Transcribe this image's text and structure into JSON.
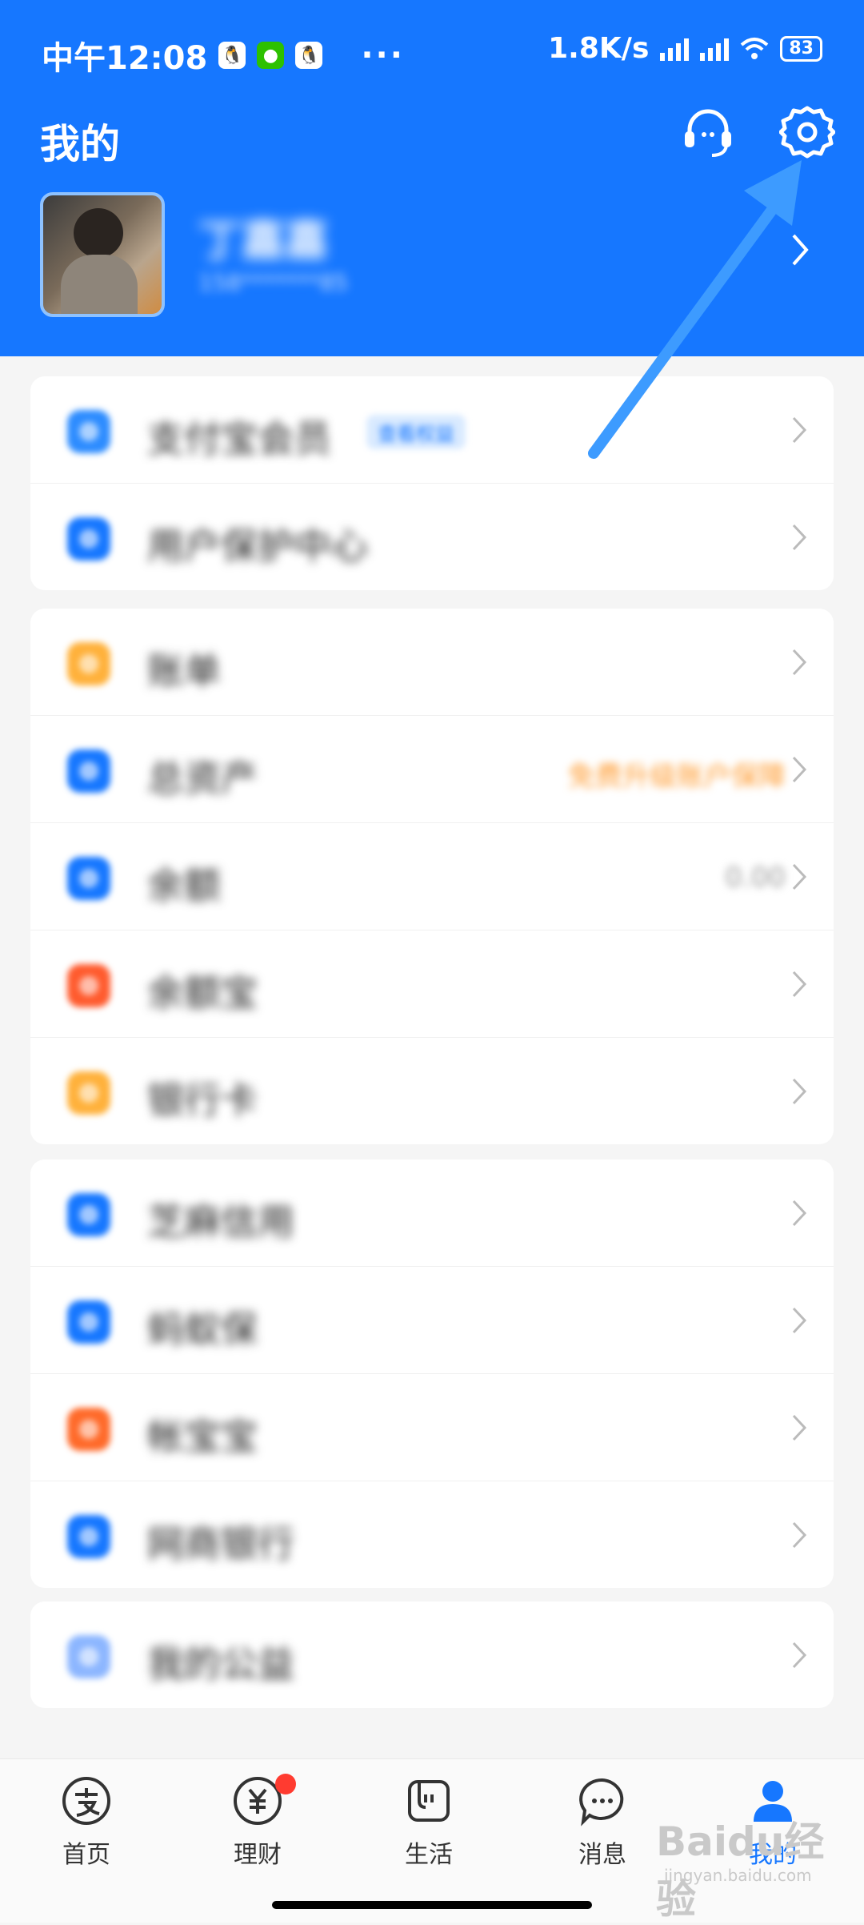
{
  "status_bar": {
    "time": "中午12:08",
    "apps": [
      "qq-icon",
      "wechat-icon",
      "qq-icon"
    ],
    "dots": "···",
    "speed": "1.8K/s",
    "battery": "83"
  },
  "header": {
    "title": "我的",
    "username": "丁嘉嘉",
    "account": "158*******85"
  },
  "cards": [
    {
      "rows": [
        {
          "name": "alipay-member",
          "label": "支付宝会员",
          "badge": "查看权益",
          "icon": "member-icon",
          "color": "#2d8cff"
        },
        {
          "name": "user-protection",
          "label": "用户保护中心",
          "icon": "shield-icon",
          "color": "#1677ff"
        }
      ]
    },
    {
      "rows": [
        {
          "name": "bill",
          "label": "账单",
          "icon": "bill-icon",
          "color": "#ffb13b"
        },
        {
          "name": "total-assets",
          "label": "总资产",
          "extra": "免费升级账户保障",
          "extra_color": "#ff9a2e",
          "icon": "assets-icon",
          "color": "#1677ff"
        },
        {
          "name": "balance",
          "label": "余额",
          "extra": "0.00",
          "extra_color": "#999999",
          "icon": "balance-icon",
          "color": "#1677ff"
        },
        {
          "name": "yuebao",
          "label": "余额宝",
          "icon": "yuebao-icon",
          "color": "#ff5b2e"
        },
        {
          "name": "bank-card",
          "label": "银行卡",
          "icon": "card-icon",
          "color": "#ffb13b"
        }
      ]
    },
    {
      "rows": [
        {
          "name": "sesame-credit",
          "label": "芝麻信用",
          "icon": "sesame-icon",
          "color": "#1677ff"
        },
        {
          "name": "ant-insurance",
          "label": "蚂蚁保",
          "icon": "insurance-icon",
          "color": "#1677ff"
        },
        {
          "name": "huabei",
          "label": "帐宝宝",
          "icon": "huabei-icon",
          "color": "#ff6a2a"
        },
        {
          "name": "mybank",
          "label": "网商银行",
          "icon": "mybank-icon",
          "color": "#1677ff"
        }
      ]
    },
    {
      "rows": [
        {
          "name": "my-charity",
          "label": "我的公益",
          "icon": "charity-icon",
          "color": "#8cb6ff"
        }
      ]
    }
  ],
  "tabs": [
    {
      "name": "home",
      "label": "首页",
      "icon": "alipay-icon"
    },
    {
      "name": "wealth",
      "label": "理财",
      "icon": "yuan-icon",
      "dot": true
    },
    {
      "name": "life",
      "label": "生活",
      "icon": "life-icon"
    },
    {
      "name": "messages",
      "label": "消息",
      "icon": "chat-icon"
    },
    {
      "name": "mine",
      "label": "我的",
      "icon": "person-icon",
      "active": true
    }
  ],
  "watermark": {
    "brand": "Baidu经验",
    "url": "jingyan.baidu.com"
  },
  "colors": {
    "brand": "#1677ff",
    "arrow": "#3d9bff"
  }
}
